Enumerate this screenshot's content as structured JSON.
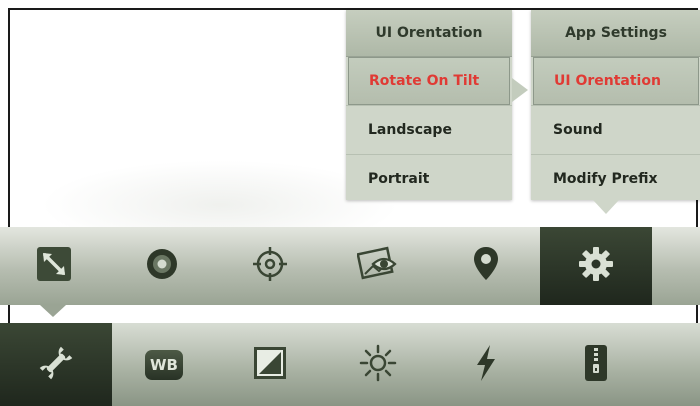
{
  "menus": {
    "orientation": {
      "title": "UI Orentation",
      "items": [
        {
          "label": "Rotate On Tilt",
          "selected": true
        },
        {
          "label": "Landscape",
          "selected": false
        },
        {
          "label": "Portrait",
          "selected": false
        }
      ]
    },
    "settings": {
      "title": "App Settings",
      "items": [
        {
          "label": "UI Orentation",
          "selected": true
        },
        {
          "label": "Sound",
          "selected": false
        },
        {
          "label": "Modify Prefix",
          "selected": false
        }
      ]
    }
  },
  "toolbar_top": {
    "icons": [
      "resize-icon",
      "lens-icon",
      "crosshair-icon",
      "image-view-icon",
      "location-pin-icon",
      "gear-icon"
    ],
    "active": "gear-icon"
  },
  "toolbar_bottom": {
    "icons": [
      "wrench-icon",
      "white-balance-icon",
      "exposure-icon",
      "brightness-icon",
      "flash-icon",
      "archive-icon"
    ],
    "active": "wrench-icon",
    "wb_label": "WB"
  },
  "colors": {
    "selected_text": "#e03a34",
    "active_tool_bg": "#2b3528"
  }
}
